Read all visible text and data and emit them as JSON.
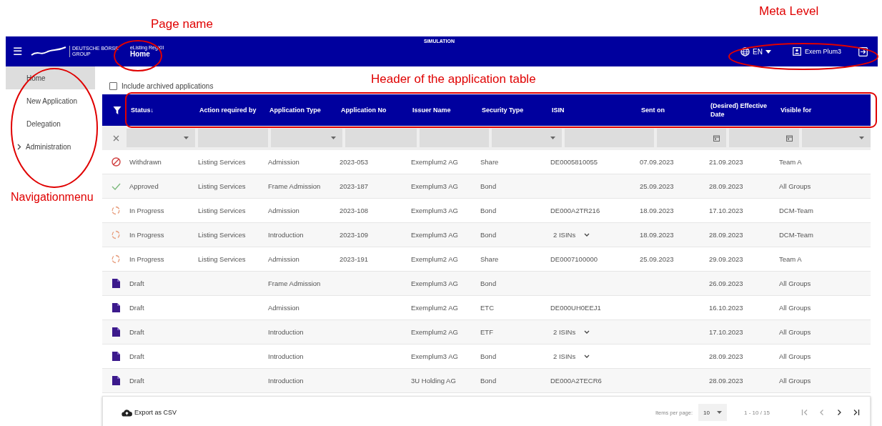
{
  "annotations": [
    {
      "text": "Page name"
    },
    {
      "text": "Meta Level"
    },
    {
      "text": "Header of the application table"
    },
    {
      "text": "Navigationmenu"
    }
  ],
  "header": {
    "menu_icon": "☰",
    "logo_line1": "DEUTSCHE BÖRSE",
    "logo_line2": "GROUP",
    "app_name": "eListing RegXII",
    "page_title": "Home",
    "environment": "SIMULATION",
    "language": "EN",
    "user": "Exem Plum3"
  },
  "sidebar": {
    "items": [
      {
        "label": "Home",
        "selected": true
      },
      {
        "label": "New Application",
        "selected": false
      },
      {
        "label": "Delegation",
        "selected": false
      },
      {
        "label": "Administration",
        "selected": false,
        "expandable": true,
        "expanded": false
      }
    ]
  },
  "archive_filter": {
    "label": "Include archived applications",
    "checked": false
  },
  "table": {
    "columns": [
      {
        "label": "Status",
        "sort_mark": "↓"
      },
      {
        "label": "Action required by"
      },
      {
        "label": "Application Type"
      },
      {
        "label": "Application No"
      },
      {
        "label": "Issuer Name"
      },
      {
        "label": "Security Type"
      },
      {
        "label": "ISIN"
      },
      {
        "label": "Sent on"
      },
      {
        "label": "(Desired) Effective Date"
      },
      {
        "label": "Visible for"
      }
    ],
    "filters": [
      {
        "kind": "select"
      },
      {
        "kind": "text"
      },
      {
        "kind": "select"
      },
      {
        "kind": "text"
      },
      {
        "kind": "text"
      },
      {
        "kind": "select"
      },
      {
        "kind": "text"
      },
      {
        "kind": "date"
      },
      {
        "kind": "date"
      },
      {
        "kind": "select"
      }
    ],
    "rows": [
      {
        "kind": "withdrawn",
        "status": "Withdrawn",
        "action": "Listing Services",
        "type": "Admission",
        "number": "2023-053",
        "issuer": "Exemplum2 AG",
        "security": "Share",
        "isin": "DE0005810055",
        "isin_expandable": false,
        "sent": "07.09.2023",
        "effective": "21.09.2023",
        "visible": "Team A"
      },
      {
        "kind": "approved",
        "status": "Approved",
        "action": "Listing Services",
        "type": "Frame Admission",
        "number": "2023-187",
        "issuer": "Exemplum3 AG",
        "security": "Bond",
        "sent": "25.09.2023",
        "effective": "28.09.2023",
        "visible": "All Groups"
      },
      {
        "kind": "in_progress",
        "status": "In Progress",
        "action": "Listing Services",
        "type": "Admission",
        "number": "2023-108",
        "issuer": "Exemplum3 AG",
        "security": "Bond",
        "isin": "DE000A2TR216",
        "isin_expandable": false,
        "sent": "18.09.2023",
        "effective": "17.10.2023",
        "visible": "DCM-Team"
      },
      {
        "kind": "in_progress",
        "status": "In Progress",
        "action": "Listing Services",
        "type": "Introduction",
        "number": "2023-109",
        "issuer": "Exemplum3 AG",
        "security": "Bond",
        "isin": "2 ISINs",
        "isin_expandable": true,
        "sent": "18.09.2023",
        "effective": "28.09.2023",
        "visible": "DCM-Team"
      },
      {
        "kind": "in_progress",
        "status": "In Progress",
        "action": "Listing Services",
        "type": "Admission",
        "number": "2023-191",
        "issuer": "Exemplum2 AG",
        "security": "Share",
        "isin": "DE0007100000",
        "isin_expandable": false,
        "sent": "25.09.2023",
        "effective": "29.09.2023",
        "visible": "Team A"
      },
      {
        "kind": "draft",
        "status": "Draft",
        "type": "Frame Admission",
        "issuer": "Exemplum3 AG",
        "security": "Bond",
        "effective": "26.09.2023",
        "visible": "All Groups"
      },
      {
        "kind": "draft",
        "status": "Draft",
        "type": "Admission",
        "issuer": "Exemplum2 AG",
        "security": "ETC",
        "isin": "DE000UH0EEJ1",
        "isin_expandable": false,
        "effective": "16.10.2023",
        "visible": "All Groups"
      },
      {
        "kind": "draft",
        "status": "Draft",
        "type": "Introduction",
        "issuer": "Exemplum2 AG",
        "security": "ETF",
        "isin": "2 ISINs",
        "isin_expandable": true,
        "effective": "17.10.2023",
        "visible": "All Groups"
      },
      {
        "kind": "draft",
        "status": "Draft",
        "type": "Introduction",
        "issuer": "Exemplum3 AG",
        "security": "Bond",
        "isin": "2 ISINs",
        "isin_expandable": true,
        "effective": "28.09.2023",
        "visible": "All Groups"
      },
      {
        "kind": "draft",
        "status": "Draft",
        "type": "Introduction",
        "issuer": "3U Holding AG",
        "security": "Bond",
        "isin": "DE000A2TECR6",
        "isin_expandable": false,
        "effective": "28.09.2023",
        "visible": "All Groups"
      }
    ]
  },
  "footer": {
    "export_label": "Export as CSV",
    "items_per_page_label": "Items per page:",
    "page_size": "10",
    "range": "1 - 10 / 15"
  }
}
